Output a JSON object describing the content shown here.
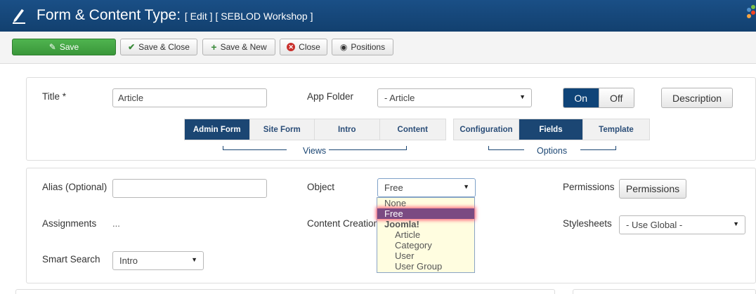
{
  "header": {
    "title": "Form & Content Type:",
    "subtitle": "[ Edit ] [ SEBLOD Workshop ]",
    "title_icon": "pen-icon",
    "logo_icon": "joomla-logo"
  },
  "toolbar": {
    "save": "Save",
    "save_close": "Save & Close",
    "save_new": "Save & New",
    "close": "Close",
    "positions": "Positions"
  },
  "form": {
    "title_label": "Title",
    "required_mark": "*",
    "title_value": "Article",
    "app_folder_label": "App Folder",
    "app_folder_value": "- Article",
    "toggle_on": "On",
    "toggle_off": "Off",
    "description_button": "Description"
  },
  "tabs": {
    "views": [
      "Admin Form",
      "Site Form",
      "Intro",
      "Content"
    ],
    "views_label": "Views",
    "options": [
      "Configuration",
      "Fields",
      "Template"
    ],
    "options_label": "Options"
  },
  "fields": {
    "alias_label": "Alias (Optional)",
    "alias_value": "",
    "object_label": "Object",
    "object_value": "Free",
    "permissions_label": "Permissions",
    "permissions_button": "Permissions",
    "assignments_label": "Assignments",
    "assignments_value": "...",
    "content_creation_label": "Content Creation",
    "stylesheets_label": "Stylesheets",
    "stylesheets_value": "- Use Global -",
    "smart_search_label": "Smart Search",
    "smart_search_value": "Intro"
  },
  "object_dropdown": {
    "options": [
      {
        "label": "None",
        "type": "option"
      },
      {
        "label": "Free",
        "type": "selected"
      },
      {
        "label": "Joomla!",
        "type": "group"
      },
      {
        "label": "Article",
        "type": "sub"
      },
      {
        "label": "Category",
        "type": "sub"
      },
      {
        "label": "User",
        "type": "sub"
      },
      {
        "label": "User Group",
        "type": "sub"
      }
    ]
  },
  "colors": {
    "header": "#12406f",
    "save_button": "#46a846",
    "active_tab": "#1b4673",
    "dropdown_bg": "#fffde0",
    "selected_option": "#7b4a82"
  }
}
